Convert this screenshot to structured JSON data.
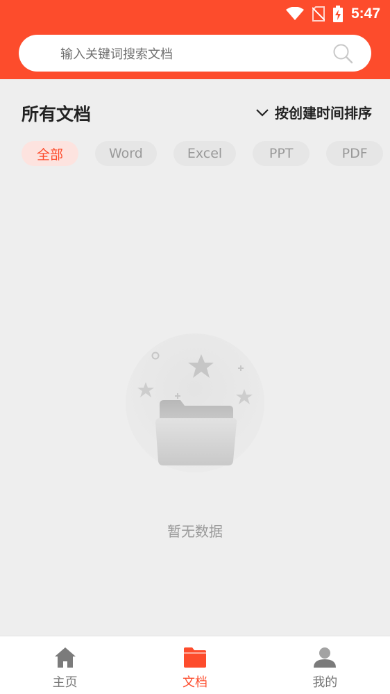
{
  "status_bar": {
    "time": "5:47"
  },
  "search": {
    "placeholder": "输入关键词搜索文档"
  },
  "section": {
    "title": "所有文档",
    "sort_label": "按创建时间排序"
  },
  "filters": [
    {
      "label": "全部",
      "active": true
    },
    {
      "label": "Word",
      "active": false
    },
    {
      "label": "Excel",
      "active": false
    },
    {
      "label": "PPT",
      "active": false
    },
    {
      "label": "PDF",
      "active": false
    }
  ],
  "empty_state": {
    "text": "暂无数据"
  },
  "tabbar": [
    {
      "label": "主页",
      "icon": "home-icon",
      "active": false
    },
    {
      "label": "文档",
      "icon": "folder-icon",
      "active": true
    },
    {
      "label": "我的",
      "icon": "user-icon",
      "active": false
    }
  ],
  "colors": {
    "accent": "#fd4c2c",
    "background": "#eeeeee"
  }
}
